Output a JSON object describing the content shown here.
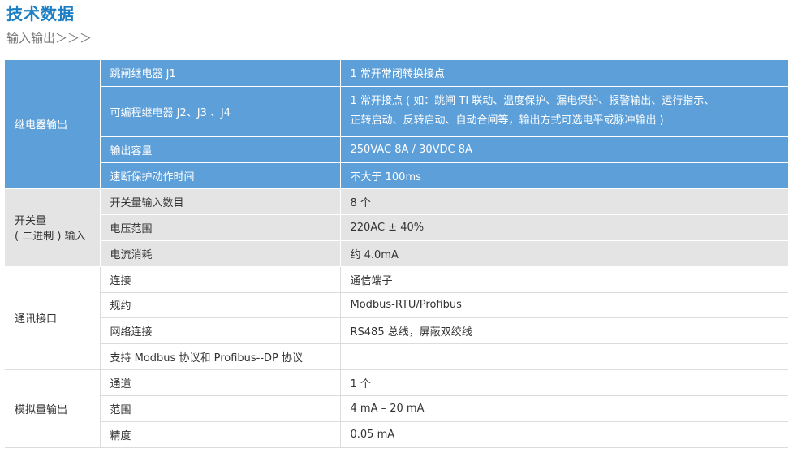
{
  "header": {
    "title": "技术数据",
    "subtitle": "输入输出＞＞＞"
  },
  "groups": {
    "relay": {
      "label": "继电器输出",
      "rows": [
        {
          "name": "跳闸继电器 J1",
          "value": "1 常开常闭转换接点"
        },
        {
          "name": "可编程继电器 J2、J3 、J4",
          "value_line1": "1 常开接点 ( 如：跳闸 TI 联动、温度保护、漏电保护、报警输出、运行指示、",
          "value_line2": "正转启动、反转启动、自动合闸等，输出方式可选电平或脉冲输出 )"
        },
        {
          "name": "输出容量",
          "value": "250VAC  8A  /  30VDC   8A"
        },
        {
          "name": "速断保护动作时间",
          "value": "不大于 100ms"
        }
      ]
    },
    "switch": {
      "label_line1": "开关量",
      "label_line2": "( 二进制 ) 输入",
      "rows": [
        {
          "name": "开关量输入数目",
          "value": "8 个"
        },
        {
          "name": "电压范围",
          "value": "220AC ± 40%"
        },
        {
          "name": "电流消耗",
          "value": "约 4.0mA"
        }
      ]
    },
    "comm": {
      "label": "通讯接口",
      "rows": [
        {
          "name": "连接",
          "value": "通信端子"
        },
        {
          "name": "规约",
          "value": "Modbus-RTU/Profibus"
        },
        {
          "name": "网络连接",
          "value": "RS485 总线，屏蔽双绞线"
        },
        {
          "name": "支持 Modbus 协议和 Profibus--DP 协议",
          "value": ""
        }
      ]
    },
    "analog": {
      "label": "模拟量输出",
      "rows": [
        {
          "name": "通道",
          "value": "1 个"
        },
        {
          "name": "范围",
          "value": "4 mA  –  20 mA"
        },
        {
          "name": "精度",
          "value": "0.05 mA"
        }
      ]
    }
  },
  "colors": {
    "title": "#1c7fc3",
    "relay_bg": "#5c9fd9",
    "switch_bg": "#e4e4e4"
  }
}
